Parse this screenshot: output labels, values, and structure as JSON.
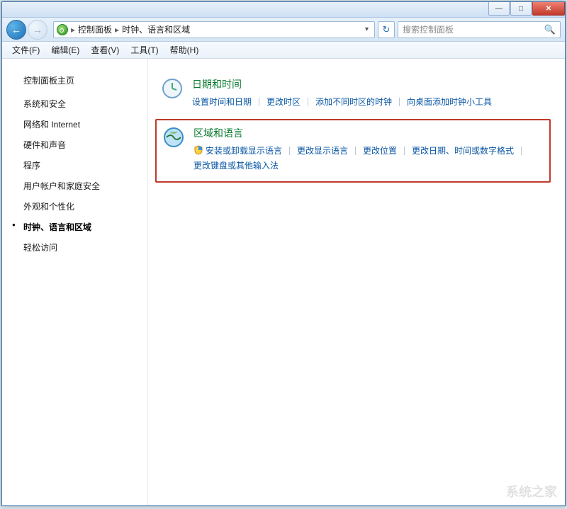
{
  "titlebar": {
    "min": "—",
    "max": "□",
    "close": "✕"
  },
  "addr": {
    "crumb1": "控制面板",
    "crumb2": "时钟、语言和区域",
    "sep": "▸",
    "dropdown": "▾",
    "refresh": "↻"
  },
  "search": {
    "placeholder": "搜索控制面板"
  },
  "menu": {
    "file": "文件(F)",
    "edit": "编辑(E)",
    "view": "查看(V)",
    "tools": "工具(T)",
    "help": "帮助(H)"
  },
  "sidebar": {
    "home": "控制面板主页",
    "items": [
      "系统和安全",
      "网络和 Internet",
      "硬件和声音",
      "程序",
      "用户帐户和家庭安全",
      "外观和个性化",
      "时钟、语言和区域",
      "轻松访问"
    ],
    "current_index": 6
  },
  "categories": [
    {
      "title": "日期和时间",
      "links": [
        "设置时间和日期",
        "更改时区",
        "添加不同时区的时钟",
        "向桌面添加时钟小工具"
      ],
      "shield_indices": []
    },
    {
      "title": "区域和语言",
      "links": [
        "安装或卸载显示语言",
        "更改显示语言",
        "更改位置",
        "更改日期、时间或数字格式",
        "更改键盘或其他输入法"
      ],
      "shield_indices": [
        0
      ],
      "highlight": true
    }
  ],
  "watermark": "系统之家"
}
